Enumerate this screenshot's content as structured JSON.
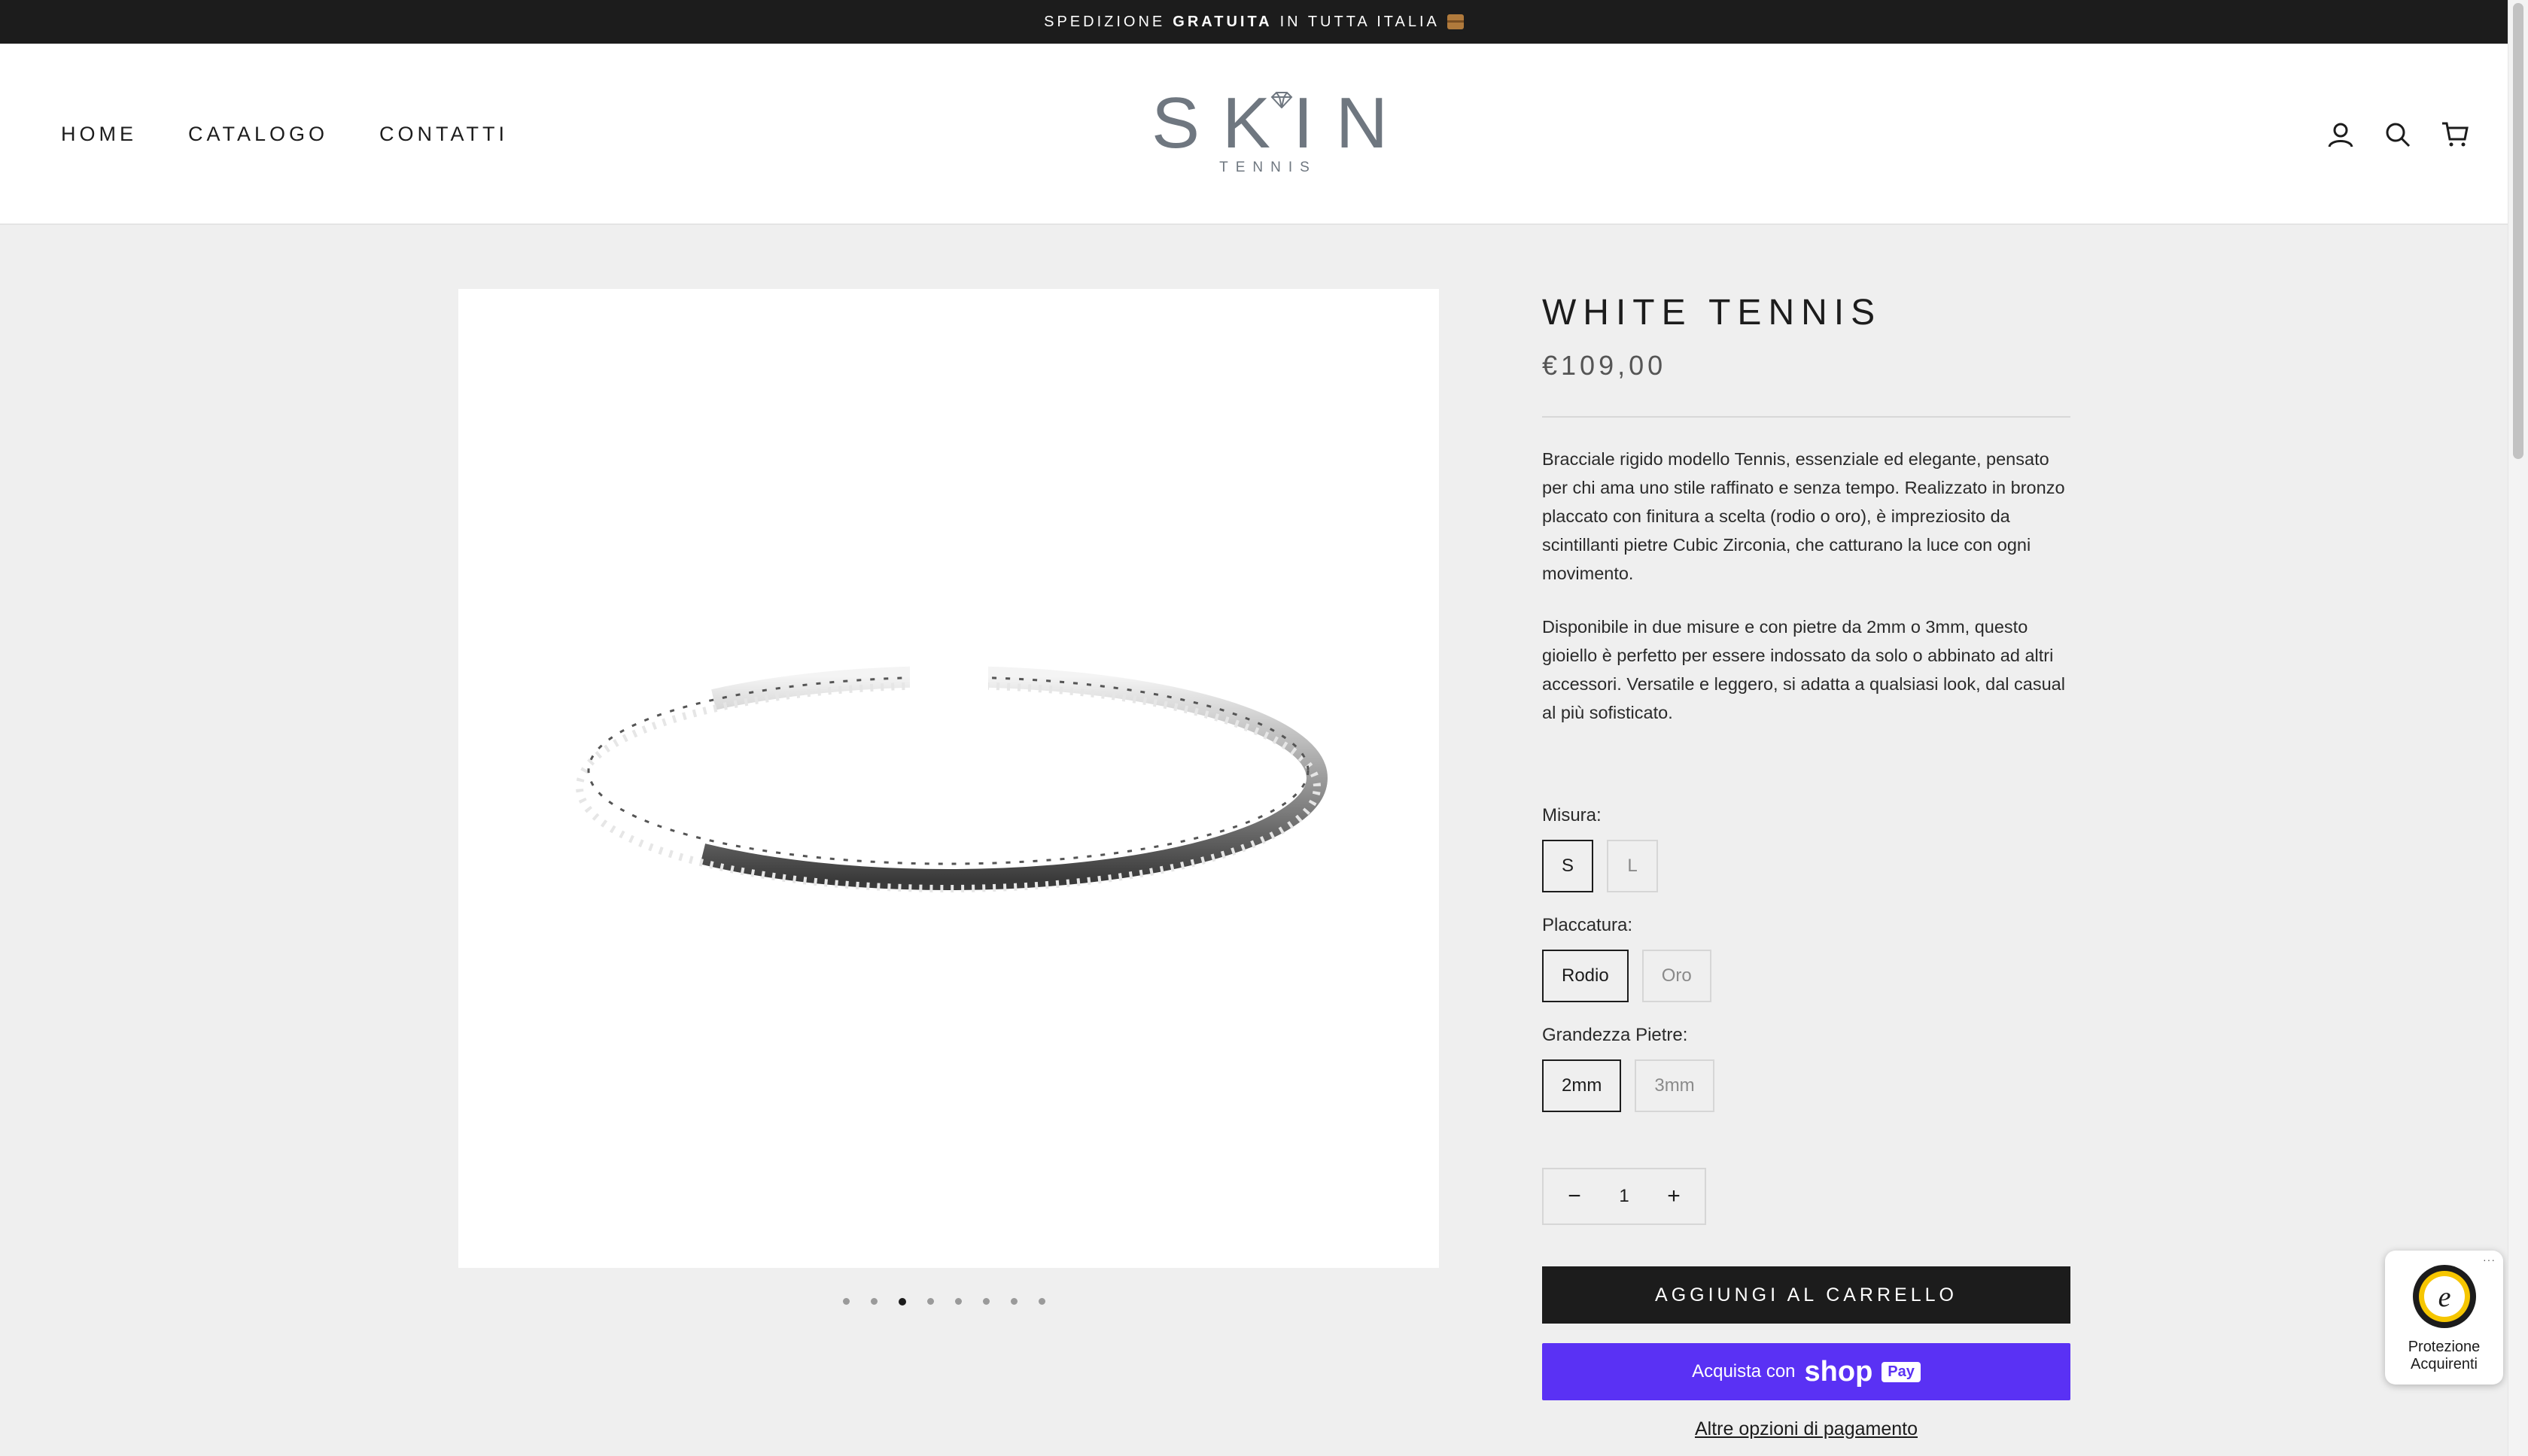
{
  "announcement": {
    "prefix": "SPEDIZIONE",
    "bold": "GRATUITA",
    "suffix": "IN TUTTA ITALIA"
  },
  "nav": {
    "items": [
      "HOME",
      "CATALOGO",
      "CONTATTI"
    ]
  },
  "logo": {
    "brand": "SKIN",
    "sub": "TENNIS"
  },
  "header_icons": [
    "account-icon",
    "search-icon",
    "cart-icon"
  ],
  "product": {
    "title": "WHITE TENNIS",
    "price": "€109,00",
    "description": [
      "Bracciale rigido modello Tennis, essenziale ed elegante, pensato per chi ama uno stile raffinato e senza tempo. Realizzato in bronzo placcato con finitura a scelta (rodio o oro), è impreziosito da scintillanti pietre Cubic Zirconia, che catturano la luce con ogni movimento.",
      "Disponibile in due misure e con pietre da 2mm o 3mm, questo gioiello è perfetto per essere indossato da solo o abbinato ad altri accessori. Versatile e leggero, si adatta a qualsiasi look, dal casual al più sofisticato."
    ],
    "options": {
      "size": {
        "label": "Misura:",
        "values": [
          "S",
          "L"
        ],
        "selected": "S"
      },
      "plating": {
        "label": "Placcatura:",
        "values": [
          "Rodio",
          "Oro"
        ],
        "selected": "Rodio"
      },
      "stone": {
        "label": "Grandezza Pietre:",
        "values": [
          "2mm",
          "3mm"
        ],
        "selected": "2mm"
      }
    },
    "quantity": {
      "value": "1",
      "minus": "−",
      "plus": "+"
    },
    "gallery": {
      "count": 8,
      "active_index": 2
    }
  },
  "buttons": {
    "add_to_cart": "AGGIUNGI AL CARRELLO",
    "shop_pay_prefix": "Acquista con",
    "shop_pay_logo": "shop",
    "shop_pay_badge": "Pay",
    "more_payment": "Altre opzioni di pagamento"
  },
  "trust_badge": {
    "line1": "Protezione",
    "line2": "Acquirenti",
    "menu": "···"
  },
  "colors": {
    "dark": "#1c1c1c",
    "shop_pay": "#5a31f4",
    "logo_gray": "#6f7780",
    "page_bg": "#efefef"
  }
}
